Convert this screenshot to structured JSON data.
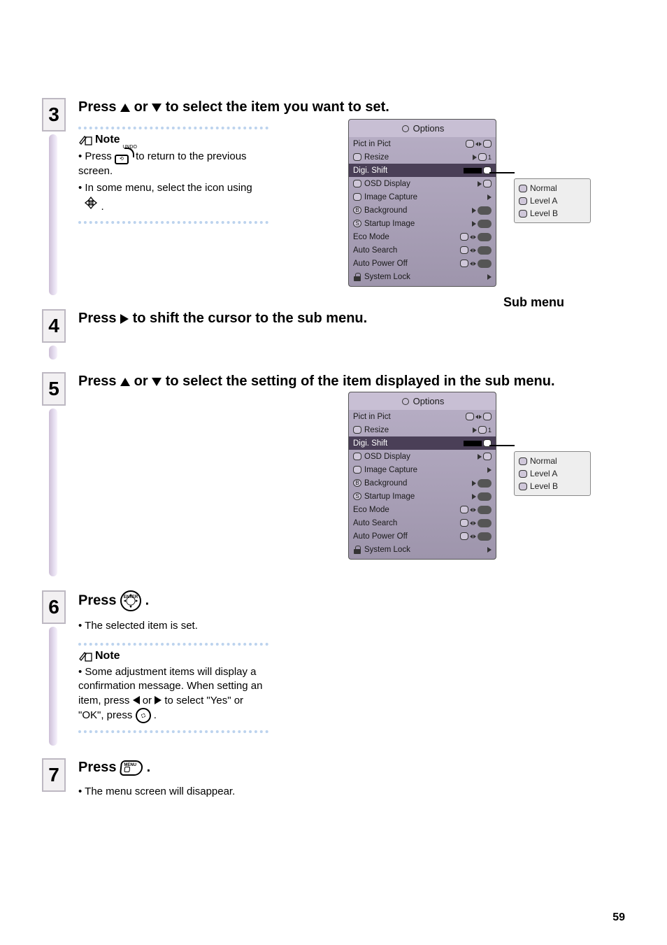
{
  "steps": {
    "s3": {
      "num": "3",
      "title_a": "Press ",
      "title_b": " or ",
      "title_c": " to select the item you want to set.",
      "note_label": "Note",
      "note1_a": "Press ",
      "note1_b": " to return to the previous screen.",
      "note2_a": "In some menu, select the icon using ",
      "note2_b": " ."
    },
    "s4": {
      "num": "4",
      "title_a": "Press",
      "title_b": "to shift the cursor to the sub menu."
    },
    "s5": {
      "num": "5",
      "title_a": "Press ",
      "title_b": " or ",
      "title_c": " to select the setting of the item displayed in the sub menu."
    },
    "s6": {
      "num": "6",
      "title_a": "Press ",
      "title_b": ".",
      "bullet": "The selected item is set.",
      "note_label": "Note",
      "note1_a": "Some adjustment items will display a confirmation message. When setting an item, press ",
      "note1_b": " or ",
      "note1_c": " to select \"Yes\" or \"OK\", press ",
      "note1_d": " ."
    },
    "s7": {
      "num": "7",
      "title_a": "Press ",
      "title_b": ".",
      "bullet": "The menu screen will disappear."
    }
  },
  "osd": {
    "title": "Options",
    "rows": [
      {
        "label": "Pict in Pict"
      },
      {
        "label": "Resize"
      },
      {
        "label": "Digi. Shift",
        "highlight": true
      },
      {
        "label": "OSD Display"
      },
      {
        "label": "Image Capture"
      },
      {
        "label": "Background"
      },
      {
        "label": "Startup Image"
      },
      {
        "label": "Eco Mode"
      },
      {
        "label": "Auto Search"
      },
      {
        "label": "Auto Power Off"
      },
      {
        "label": "System Lock"
      }
    ]
  },
  "submenu": {
    "items": [
      "Normal",
      "Level A",
      "Level B"
    ],
    "caption": "Sub menu"
  },
  "page_number": "59"
}
